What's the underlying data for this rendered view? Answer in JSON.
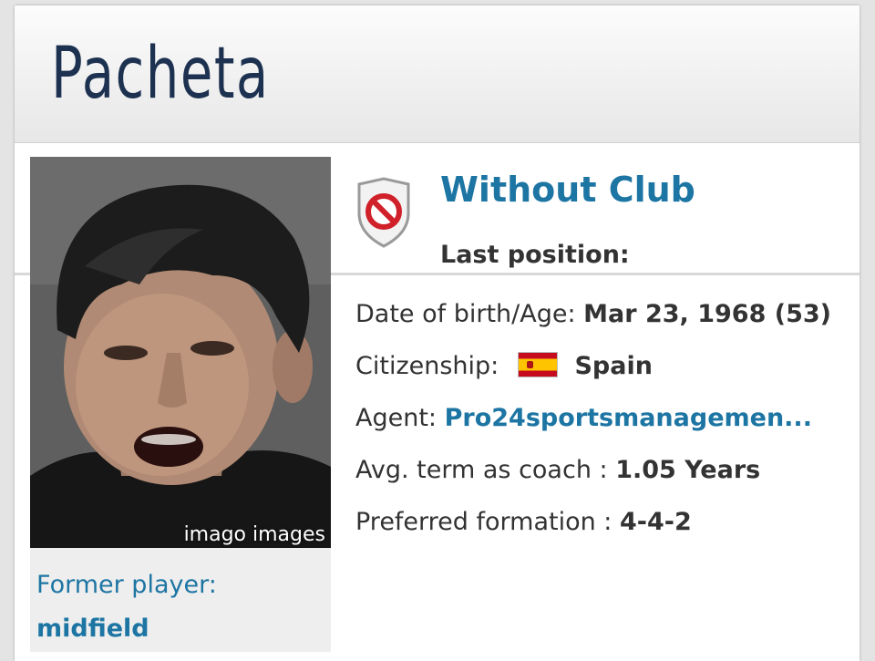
{
  "profile": {
    "name": "Pacheta",
    "photo_credit": "imago images",
    "former_player_label": "Former player:",
    "former_player_value": "midfield"
  },
  "club": {
    "name": "Without Club",
    "icon": "no-club-shield-icon",
    "last_position_label": "Last position:"
  },
  "info": {
    "dob_label": "Date of birth/Age:",
    "dob_value": "Mar 23, 1968 (53)",
    "citizenship_label": "Citizenship:",
    "citizenship_value": "Spain",
    "citizenship_flag": "spain-flag-icon",
    "agent_label": "Agent:",
    "agent_value": "Pro24sportsmanagemen...",
    "avg_term_label": "Avg. term as coach :",
    "avg_term_value": "1.05 Years",
    "formation_label": "Preferred formation :",
    "formation_value": "4-4-2"
  },
  "colors": {
    "title": "#1d3150",
    "link": "#1d75a3",
    "text": "#333333",
    "prohibit_red": "#d0202a"
  }
}
